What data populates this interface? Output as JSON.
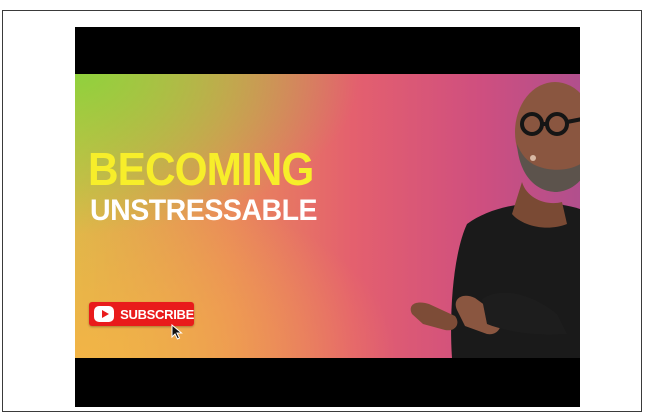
{
  "thumbnail": {
    "title_line1": "BECOMING",
    "title_line2": "UNSTRESSABLE",
    "subscribe_label": "SUBSCRIBE",
    "icons": [
      "youtube-play-icon",
      "mouse-pointer-icon"
    ],
    "colors": {
      "title_yellow": "#f7ee2a",
      "title_white": "#ffffff",
      "subscribe_red": "#e91b1b",
      "gradient_left": "#8fd23c",
      "gradient_right": "#b14f8d"
    }
  }
}
